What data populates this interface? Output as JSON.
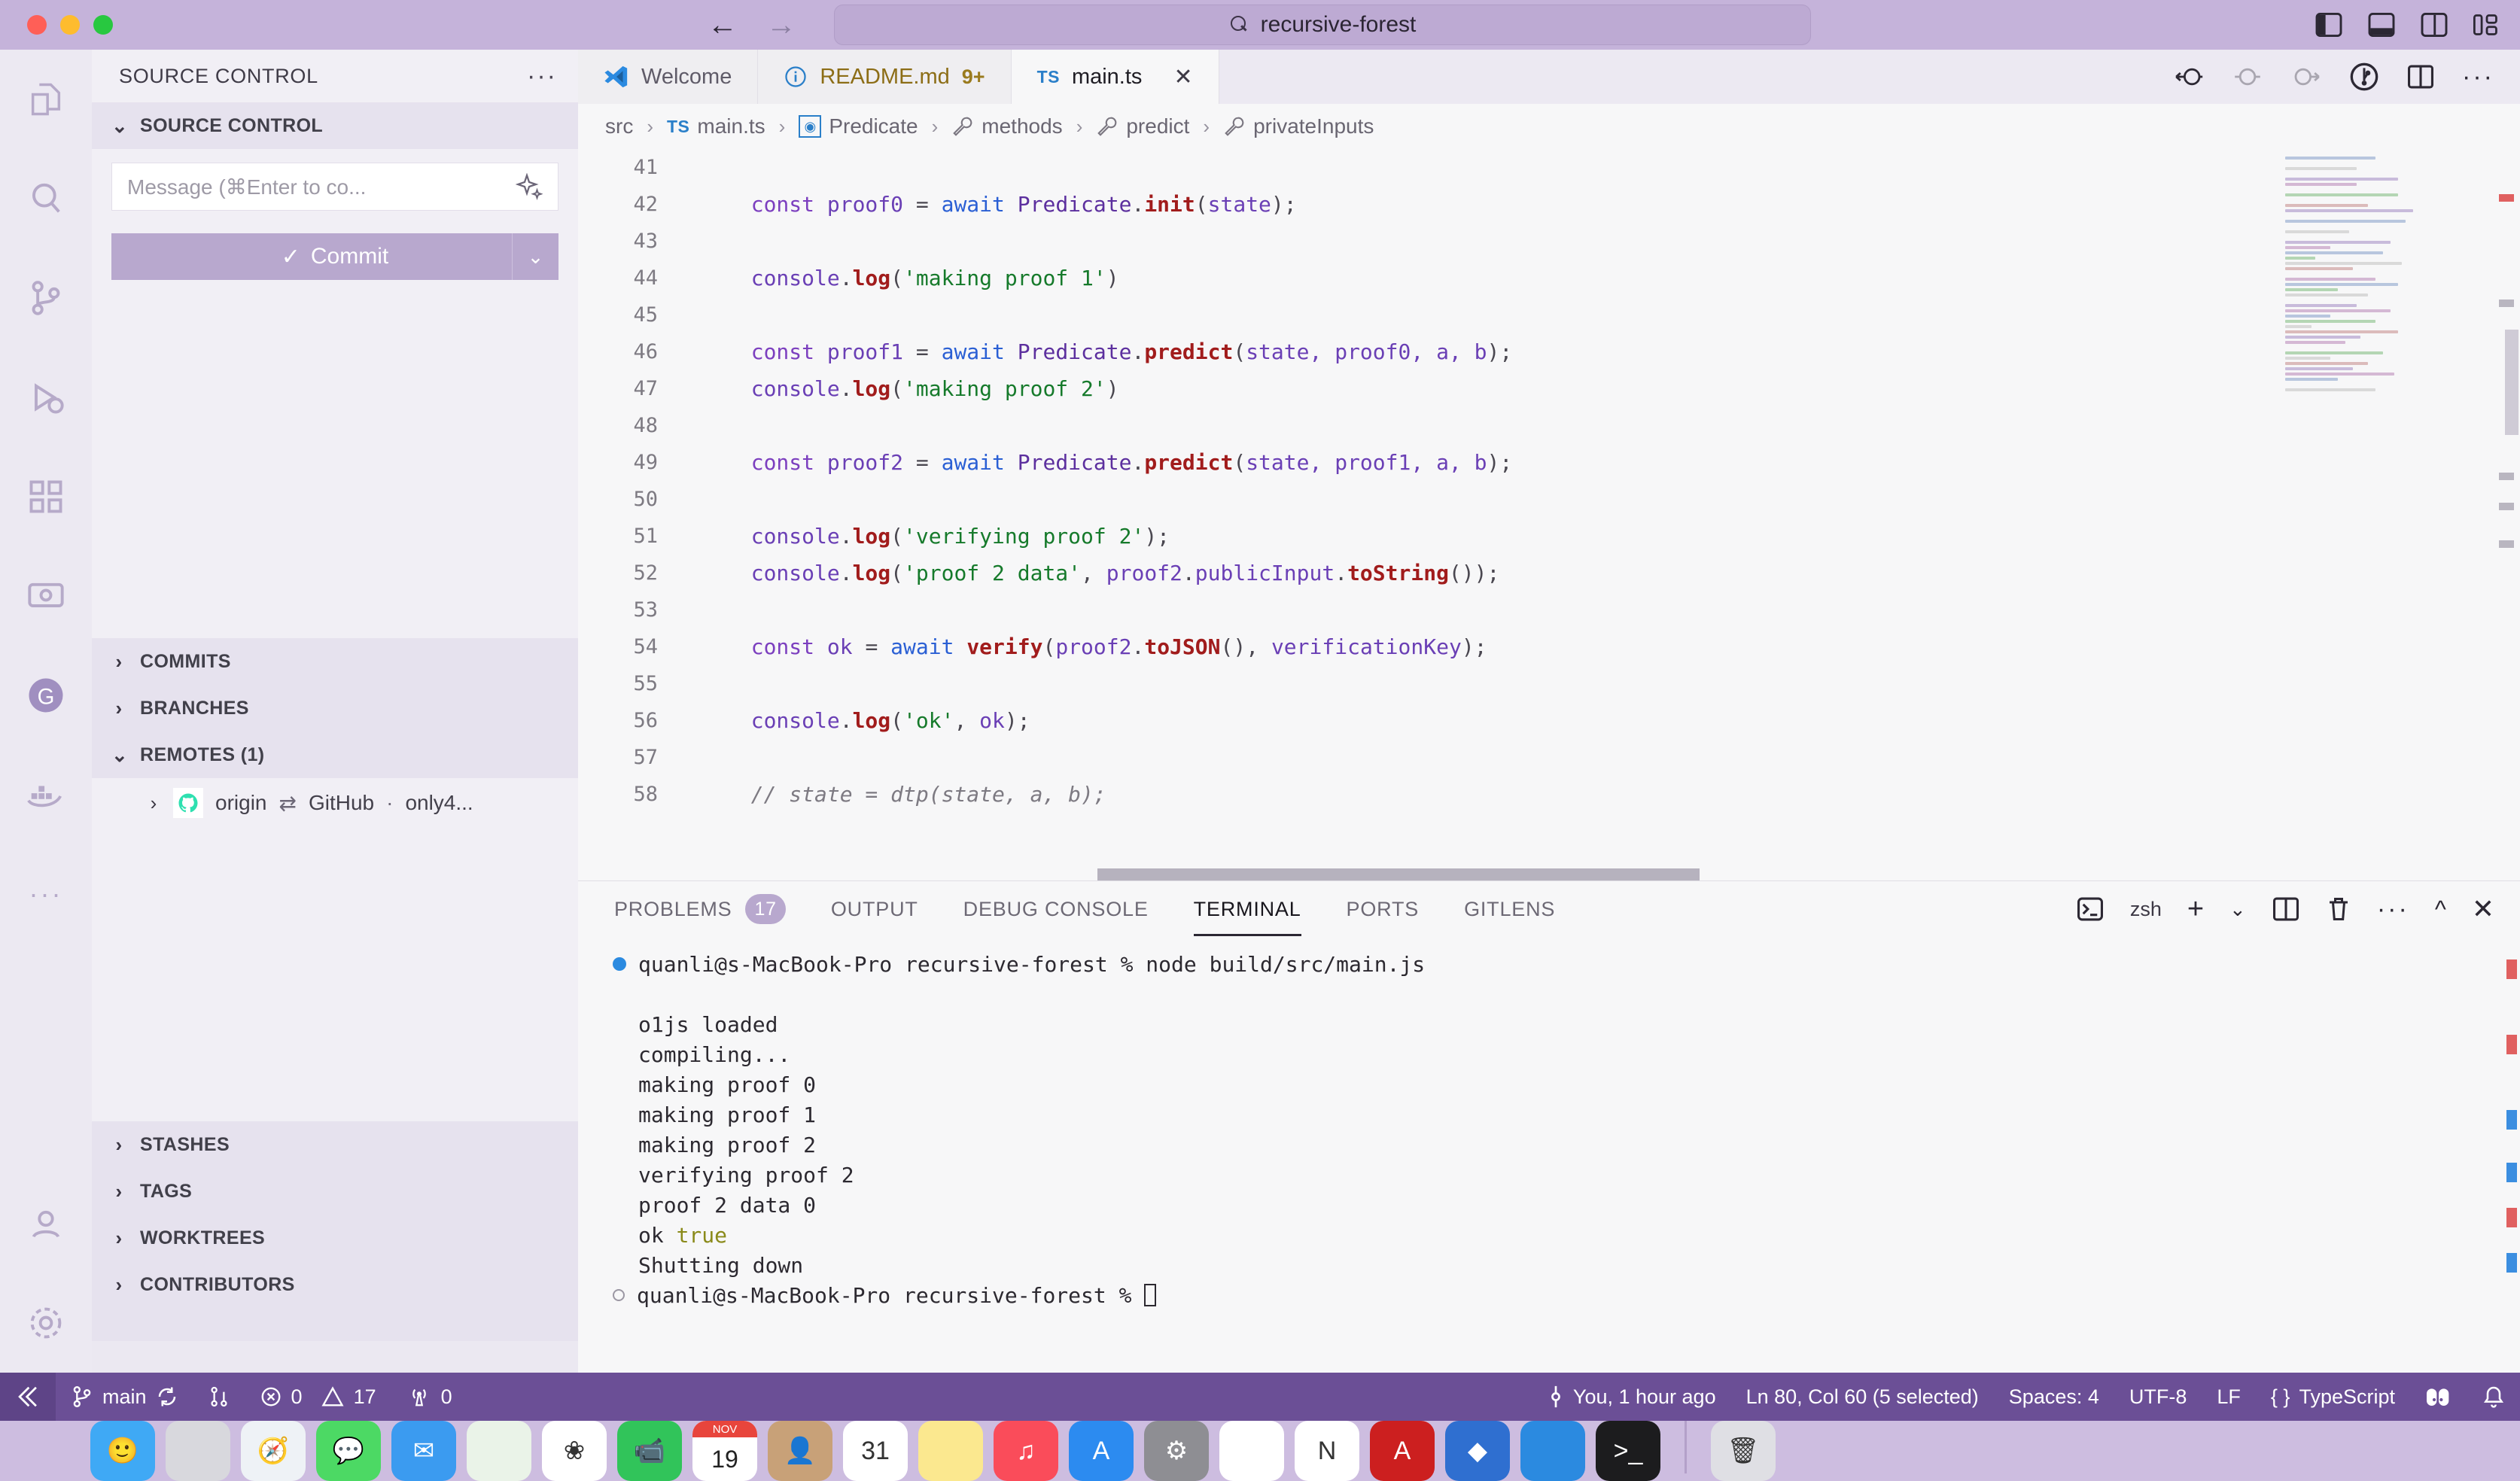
{
  "titlebar": {
    "search_text": "recursive-forest",
    "search_icon": "search-icon",
    "back_icon": "arrow-left-icon",
    "forward_icon": "arrow-right-icon",
    "layout_icons": [
      "toggle-primary-sidebar-icon",
      "toggle-panel-icon",
      "toggle-secondary-sidebar-icon",
      "customize-layout-icon"
    ]
  },
  "activitybar": {
    "items": [
      {
        "name": "explorer",
        "icon": "files-icon"
      },
      {
        "name": "search",
        "icon": "search-icon"
      },
      {
        "name": "source-control",
        "icon": "source-control-icon"
      },
      {
        "name": "run-and-debug",
        "icon": "debug-icon"
      },
      {
        "name": "extensions",
        "icon": "extensions-icon"
      },
      {
        "name": "remote-explorer",
        "icon": "remote-explorer-icon"
      },
      {
        "name": "gitlens",
        "icon": "gitlens-icon"
      },
      {
        "name": "docker",
        "icon": "docker-icon"
      },
      {
        "name": "more",
        "icon": "ellipsis-icon"
      },
      {
        "name": "accounts",
        "icon": "account-icon"
      },
      {
        "name": "settings",
        "icon": "gear-icon"
      }
    ]
  },
  "sidebar": {
    "title": "SOURCE CONTROL",
    "more_actions": "···",
    "scm": {
      "header": "SOURCE CONTROL",
      "message_placeholder": "Message (⌘Enter to co...",
      "sparkle_icon": "sparkle-icon",
      "commit_label": "Commit",
      "commit_check": "✓",
      "commit_dropdown": "⌄"
    },
    "sections": [
      {
        "label": "COMMITS",
        "expanded": false
      },
      {
        "label": "BRANCHES",
        "expanded": false
      },
      {
        "label": "REMOTES (1)",
        "expanded": true
      },
      {
        "label": "STASHES",
        "expanded": false
      },
      {
        "label": "TAGS",
        "expanded": false
      },
      {
        "label": "WORKTREES",
        "expanded": false
      },
      {
        "label": "CONTRIBUTORS",
        "expanded": false
      }
    ],
    "remote_row": {
      "name": "origin",
      "sync_icon": "⇄",
      "provider": "GitHub",
      "dot": "·",
      "repo": "only4...",
      "octocat_icon": "octocat-icon"
    }
  },
  "editor": {
    "tabs": [
      {
        "label": "Welcome",
        "icon": "vscode-logo-icon",
        "active": false,
        "badge": ""
      },
      {
        "label": "README.md",
        "icon": "info-icon",
        "active": false,
        "badge": "9+"
      },
      {
        "label": "main.ts",
        "icon": "ts-icon",
        "icon_text": "TS",
        "active": true,
        "badge": "",
        "close": "✕"
      }
    ],
    "actions": [
      "go-back-icon",
      "no-change-icon",
      "go-forward-icon",
      "gitlens-inspect-icon",
      "split-editor-icon",
      "more-actions-icon"
    ],
    "breadcrumbs": [
      {
        "label": "src",
        "icon": ""
      },
      {
        "label": "main.ts",
        "icon": "ts-icon",
        "icon_text": "TS"
      },
      {
        "label": "Predicate",
        "icon": "class-icon"
      },
      {
        "label": "methods",
        "icon": "property-icon"
      },
      {
        "label": "predict",
        "icon": "property-icon"
      },
      {
        "label": "privateInputs",
        "icon": "property-icon"
      }
    ],
    "code_lines": [
      {
        "num": "41",
        "tokens": []
      },
      {
        "num": "42",
        "tokens": [
          {
            "t": "  const ",
            "c": "k-const"
          },
          {
            "t": "proof0 ",
            "c": "k-var"
          },
          {
            "t": "= ",
            "c": "k-punc"
          },
          {
            "t": "await ",
            "c": "k-await"
          },
          {
            "t": "Predicate",
            "c": "k-type"
          },
          {
            "t": ".",
            "c": "k-punc"
          },
          {
            "t": "init",
            "c": "k-fn"
          },
          {
            "t": "(",
            "c": "k-punc"
          },
          {
            "t": "state",
            "c": "k-var"
          },
          {
            "t": ");",
            "c": "k-punc"
          }
        ]
      },
      {
        "num": "43",
        "tokens": []
      },
      {
        "num": "44",
        "tokens": [
          {
            "t": "  console",
            "c": "k-var"
          },
          {
            "t": ".",
            "c": "k-punc"
          },
          {
            "t": "log",
            "c": "k-fn"
          },
          {
            "t": "(",
            "c": "k-punc"
          },
          {
            "t": "'making proof 1'",
            "c": "k-str"
          },
          {
            "t": ")",
            "c": "k-punc"
          }
        ]
      },
      {
        "num": "45",
        "tokens": []
      },
      {
        "num": "46",
        "tokens": [
          {
            "t": "  const ",
            "c": "k-const"
          },
          {
            "t": "proof1 ",
            "c": "k-var"
          },
          {
            "t": "= ",
            "c": "k-punc"
          },
          {
            "t": "await ",
            "c": "k-await"
          },
          {
            "t": "Predicate",
            "c": "k-type"
          },
          {
            "t": ".",
            "c": "k-punc"
          },
          {
            "t": "predict",
            "c": "k-fn"
          },
          {
            "t": "(",
            "c": "k-punc"
          },
          {
            "t": "state, proof0, a, b",
            "c": "k-var"
          },
          {
            "t": ");",
            "c": "k-punc"
          }
        ]
      },
      {
        "num": "47",
        "tokens": [
          {
            "t": "  console",
            "c": "k-var"
          },
          {
            "t": ".",
            "c": "k-punc"
          },
          {
            "t": "log",
            "c": "k-fn"
          },
          {
            "t": "(",
            "c": "k-punc"
          },
          {
            "t": "'making proof 2'",
            "c": "k-str"
          },
          {
            "t": ")",
            "c": "k-punc"
          }
        ]
      },
      {
        "num": "48",
        "tokens": []
      },
      {
        "num": "49",
        "tokens": [
          {
            "t": "  const ",
            "c": "k-const"
          },
          {
            "t": "proof2 ",
            "c": "k-var"
          },
          {
            "t": "= ",
            "c": "k-punc"
          },
          {
            "t": "await ",
            "c": "k-await"
          },
          {
            "t": "Predicate",
            "c": "k-type"
          },
          {
            "t": ".",
            "c": "k-punc"
          },
          {
            "t": "predict",
            "c": "k-fn"
          },
          {
            "t": "(",
            "c": "k-punc"
          },
          {
            "t": "state, proof1, a, b",
            "c": "k-var"
          },
          {
            "t": ");",
            "c": "k-punc"
          }
        ]
      },
      {
        "num": "50",
        "tokens": []
      },
      {
        "num": "51",
        "tokens": [
          {
            "t": "  console",
            "c": "k-var"
          },
          {
            "t": ".",
            "c": "k-punc"
          },
          {
            "t": "log",
            "c": "k-fn"
          },
          {
            "t": "(",
            "c": "k-punc"
          },
          {
            "t": "'verifying proof 2'",
            "c": "k-str"
          },
          {
            "t": ");",
            "c": "k-punc"
          }
        ]
      },
      {
        "num": "52",
        "tokens": [
          {
            "t": "  console",
            "c": "k-var"
          },
          {
            "t": ".",
            "c": "k-punc"
          },
          {
            "t": "log",
            "c": "k-fn"
          },
          {
            "t": "(",
            "c": "k-punc"
          },
          {
            "t": "'proof 2 data'",
            "c": "k-str"
          },
          {
            "t": ", ",
            "c": "k-punc"
          },
          {
            "t": "proof2",
            "c": "k-var"
          },
          {
            "t": ".",
            "c": "k-punc"
          },
          {
            "t": "publicInput",
            "c": "k-var"
          },
          {
            "t": ".",
            "c": "k-punc"
          },
          {
            "t": "toString",
            "c": "k-fn"
          },
          {
            "t": "());",
            "c": "k-punc"
          }
        ]
      },
      {
        "num": "53",
        "tokens": []
      },
      {
        "num": "54",
        "tokens": [
          {
            "t": "  const ",
            "c": "k-const"
          },
          {
            "t": "ok ",
            "c": "k-var"
          },
          {
            "t": "= ",
            "c": "k-punc"
          },
          {
            "t": "await ",
            "c": "k-await"
          },
          {
            "t": "verify",
            "c": "k-fn"
          },
          {
            "t": "(",
            "c": "k-punc"
          },
          {
            "t": "proof2",
            "c": "k-var"
          },
          {
            "t": ".",
            "c": "k-punc"
          },
          {
            "t": "toJSON",
            "c": "k-fn"
          },
          {
            "t": "(), ",
            "c": "k-punc"
          },
          {
            "t": "verificationKey",
            "c": "k-var"
          },
          {
            "t": ");",
            "c": "k-punc"
          }
        ]
      },
      {
        "num": "55",
        "tokens": []
      },
      {
        "num": "56",
        "tokens": [
          {
            "t": "  console",
            "c": "k-var"
          },
          {
            "t": ".",
            "c": "k-punc"
          },
          {
            "t": "log",
            "c": "k-fn"
          },
          {
            "t": "(",
            "c": "k-punc"
          },
          {
            "t": "'ok'",
            "c": "k-str"
          },
          {
            "t": ", ",
            "c": "k-punc"
          },
          {
            "t": "ok",
            "c": "k-var"
          },
          {
            "t": ");",
            "c": "k-punc"
          }
        ]
      },
      {
        "num": "57",
        "tokens": []
      },
      {
        "num": "58",
        "tokens": [
          {
            "t": "  // state = dtp(state, a, b);",
            "c": "k-cmt"
          }
        ]
      }
    ]
  },
  "panel": {
    "tabs": [
      {
        "label": "PROBLEMS",
        "badge": "17",
        "active": false
      },
      {
        "label": "OUTPUT",
        "badge": "",
        "active": false
      },
      {
        "label": "DEBUG CONSOLE",
        "badge": "",
        "active": false
      },
      {
        "label": "TERMINAL",
        "badge": "",
        "active": true
      },
      {
        "label": "PORTS",
        "badge": "",
        "active": false
      },
      {
        "label": "GITLENS",
        "badge": "",
        "active": false
      }
    ],
    "shell_label": "zsh",
    "actions": [
      "launch-profile-icon",
      "new-terminal-icon",
      "split-terminal-icon",
      "kill-terminal-icon",
      "more-actions-icon",
      "maximize-panel-icon",
      "close-panel-icon"
    ],
    "terminal_lines": [
      {
        "marker": "success",
        "text": "quanli@s-MacBook-Pro recursive-forest % node build/src/main.js"
      },
      {
        "marker": "none",
        "text": ""
      },
      {
        "marker": "none",
        "text": "o1js loaded"
      },
      {
        "marker": "none",
        "text": "compiling..."
      },
      {
        "marker": "none",
        "text": "making proof 0"
      },
      {
        "marker": "none",
        "text": "making proof 1"
      },
      {
        "marker": "none",
        "text": "making proof 2"
      },
      {
        "marker": "none",
        "text": "verifying proof 2"
      },
      {
        "marker": "none",
        "text": "proof 2 data 0"
      },
      {
        "marker": "none",
        "text": "ok ",
        "highlight": "true"
      },
      {
        "marker": "none",
        "text": "Shutting down"
      },
      {
        "marker": "prompt",
        "text": "quanli@s-MacBook-Pro recursive-forest % ",
        "cursor": true
      }
    ]
  },
  "statusbar": {
    "remote_icon": "remote-window-icon",
    "branch_icon": "git-branch-icon",
    "branch": "main",
    "sync_icon": "sync-icon",
    "compare_icon": "git-compare-icon",
    "errors_icon": "error-icon",
    "errors": "0",
    "warnings_icon": "warning-icon",
    "warnings": "17",
    "ports_icon": "radio-tower-icon",
    "ports": "0",
    "blame_icon": "git-commit-icon",
    "blame": "You, 1 hour ago",
    "cursor_position": "Ln 80, Col 60 (5 selected)",
    "indentation": "Spaces: 4",
    "encoding": "UTF-8",
    "eol": "LF",
    "language_icon": "{ }",
    "language": "TypeScript",
    "live_share_icon": "live-share-icon",
    "bell_icon": "bell-icon"
  },
  "dock": {
    "items": [
      {
        "name": "finder",
        "color": "#3fa9f5",
        "glyph": "🙂"
      },
      {
        "name": "launchpad",
        "color": "#d8d8dd",
        "glyph": ""
      },
      {
        "name": "safari",
        "color": "#eef2f6",
        "glyph": "🧭"
      },
      {
        "name": "messages",
        "color": "#4cd964",
        "glyph": "💬"
      },
      {
        "name": "mail",
        "color": "#3b9bf0",
        "glyph": "✉"
      },
      {
        "name": "maps-apple",
        "color": "#eaf3e8",
        "glyph": ""
      },
      {
        "name": "photos",
        "color": "#ffffff",
        "glyph": "❀"
      },
      {
        "name": "facetime",
        "color": "#31c45a",
        "glyph": "📹"
      },
      {
        "name": "calendar",
        "color": "#ffffff",
        "glyph": "19",
        "sub": "NOV"
      },
      {
        "name": "contacts",
        "color": "#c8a178",
        "glyph": "👤"
      },
      {
        "name": "reminders",
        "color": "#ffffff",
        "glyph": "31"
      },
      {
        "name": "notes",
        "color": "#fbe88f",
        "glyph": ""
      },
      {
        "name": "music",
        "color": "#fa4c5a",
        "glyph": "♫"
      },
      {
        "name": "app-store",
        "color": "#2c8bf0",
        "glyph": "A"
      },
      {
        "name": "system-settings",
        "color": "#8e8e93",
        "glyph": "⚙"
      },
      {
        "name": "chrome",
        "color": "#ffffff",
        "glyph": ""
      },
      {
        "name": "notion",
        "color": "#ffffff",
        "glyph": "N"
      },
      {
        "name": "acrobat",
        "color": "#cc1f1f",
        "glyph": "A"
      },
      {
        "name": "supabase",
        "color": "#2f6fd0",
        "glyph": "◆"
      },
      {
        "name": "vscode",
        "color": "#2b8ae0",
        "glyph": ""
      },
      {
        "name": "terminal",
        "color": "#1c1c1e",
        "glyph": ">_"
      },
      {
        "name": "trash",
        "color": "#dfdfe4",
        "glyph": "🗑"
      }
    ]
  }
}
